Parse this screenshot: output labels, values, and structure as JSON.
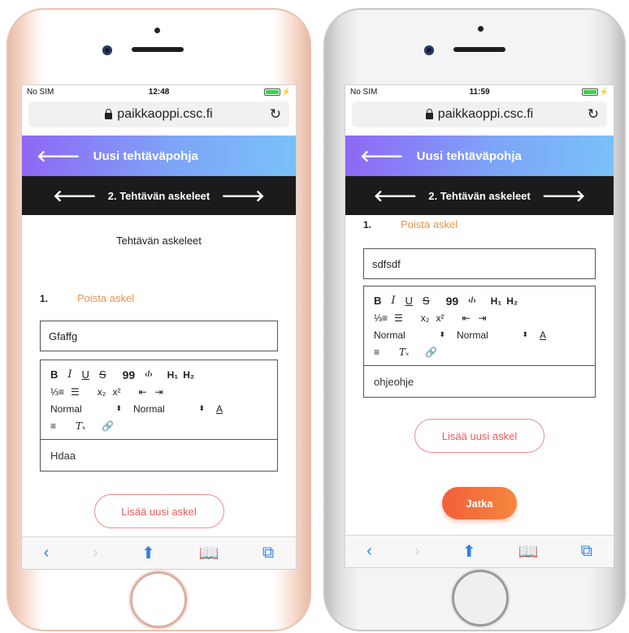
{
  "colors": {
    "header_gradient": [
      "#8f67f5",
      "#79c1f8"
    ],
    "stepbar": "#1b1b1b",
    "remove_link": "#e8944f",
    "add_button_text": "#ec5c5c",
    "next_button": "#f25f3a",
    "ios_blue": "#2f80ed",
    "battery": "#3ccf4e"
  },
  "left": {
    "status": {
      "carrier": "No SIM",
      "time": "12:48",
      "charge": "⚡"
    },
    "browser": {
      "url": "paikkaoppi.csc.fi",
      "reload_icon": "↻"
    },
    "header": {
      "back_icon": "🡐",
      "title": "Uusi tehtäväpohja"
    },
    "stepnav": {
      "prev_icon": "🡐",
      "label": "2. Tehtävän askeleet",
      "next_icon": "🡒"
    },
    "section_title": "Tehtävän askeleet",
    "step": {
      "number": "1.",
      "remove_label": "Poista askel",
      "title_value": "Gfaffg"
    },
    "toolbar": {
      "bold": "B",
      "italic": "I",
      "underline": "U",
      "strike": "S",
      "quote": "99",
      "code": "‹/›",
      "h1": "H₁",
      "h2": "H₂",
      "ordered_list": "⅓≡",
      "bullet_list": "☰",
      "subscript": "x₂",
      "superscript": "x²",
      "outdent": "⇤",
      "indent": "⇥",
      "size_select": "Normal",
      "font_select": "Normal",
      "select_caret": "⬍",
      "text_color": "A",
      "align": "≡",
      "clear_format": "Tₓ",
      "link": "🔗"
    },
    "editor_text": "Hdaa",
    "add_step_label": "Lisää uusi askel",
    "bottom": {
      "back": "‹",
      "forward": "›",
      "share": "⬆",
      "bookmarks": "📖",
      "tabs": "⧉"
    }
  },
  "right": {
    "status": {
      "carrier": "No SIM",
      "time": "11:59",
      "charge": "⚡"
    },
    "browser": {
      "url": "paikkaoppi.csc.fi",
      "reload_icon": "↻"
    },
    "header": {
      "back_icon": "🡐",
      "title": "Uusi tehtäväpohja"
    },
    "stepnav": {
      "prev_icon": "🡐",
      "label": "2. Tehtävän askeleet",
      "next_icon": "🡒"
    },
    "step": {
      "number": "1.",
      "remove_label": "Poista askel",
      "title_value": "sdfsdf"
    },
    "toolbar": {
      "bold": "B",
      "italic": "I",
      "underline": "U",
      "strike": "S",
      "quote": "99",
      "code": "‹/›",
      "h1": "H₁",
      "h2": "H₂",
      "ordered_list": "⅓≡",
      "bullet_list": "☰",
      "subscript": "x₂",
      "superscript": "x²",
      "outdent": "⇤",
      "indent": "⇥",
      "size_select": "Normal",
      "font_select": "Normal",
      "select_caret": "⬍",
      "text_color": "A",
      "align": "≡",
      "clear_format": "Tₓ",
      "link": "🔗"
    },
    "editor_text": "ohjeohje",
    "add_step_label": "Lisää uusi askel",
    "next_label": "Jatka",
    "bottom": {
      "back": "‹",
      "forward": "›",
      "share": "⬆",
      "bookmarks": "📖",
      "tabs": "⧉"
    }
  }
}
